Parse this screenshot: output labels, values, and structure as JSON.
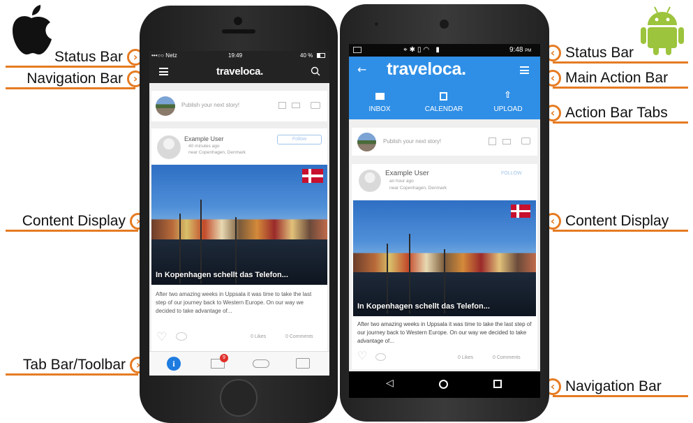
{
  "callouts": {
    "left": {
      "status_bar": "Status Bar",
      "navigation_bar": "Navigation Bar",
      "content_display": "Content Display",
      "tab_bar": "Tab Bar/Toolbar"
    },
    "right": {
      "status_bar": "Status Bar",
      "main_action_bar": "Main Action Bar",
      "action_bar_tabs": "Action Bar Tabs",
      "content_display": "Content Display",
      "navigation_bar": "Navigation Bar"
    }
  },
  "ios": {
    "status": {
      "carrier": "•••○○ Netz",
      "time": "19:49",
      "battery": "40 %"
    },
    "logo": "traveloca.",
    "story_prompt": "Publish your next story!",
    "post": {
      "user": "Example User",
      "follow_label": "Follow",
      "time": "40 minutes ago",
      "location": "near Copenhagen, Denmark",
      "caption": "In Kopenhagen schellt das Telefon...",
      "excerpt": "After two amazing weeks in Uppsala it was time to take the last step of our journey back to Western Europe. On our way we decided to take advantage of...",
      "likes": "0 Likes",
      "comments": "0 Comments"
    },
    "tabbar": {
      "badge": "9"
    }
  },
  "android": {
    "status": {
      "time": "9:48",
      "ampm": "PM"
    },
    "logo": "traveloca.",
    "tabs": [
      "INBOX",
      "CALENDAR",
      "UPLOAD"
    ],
    "story_prompt": "Publish your next story!",
    "post": {
      "user": "Example User",
      "follow_label": "FOLLOW",
      "time": "an hour ago",
      "location": "near Copenhagen, Denmark",
      "caption": "In Kopenhagen schellt das Telefon...",
      "excerpt": "After two amazing weeks in Uppsala it was time to take the last step of our journey back to Western Europe. On our way we decided to take advantage of...",
      "likes": "0 Likes",
      "comments": "0 Comments"
    }
  },
  "colors": {
    "accent": "#e57b22",
    "android_blue": "#2f8fe6",
    "ios_blue": "#1e7be0",
    "android_green": "#9cc43c"
  }
}
